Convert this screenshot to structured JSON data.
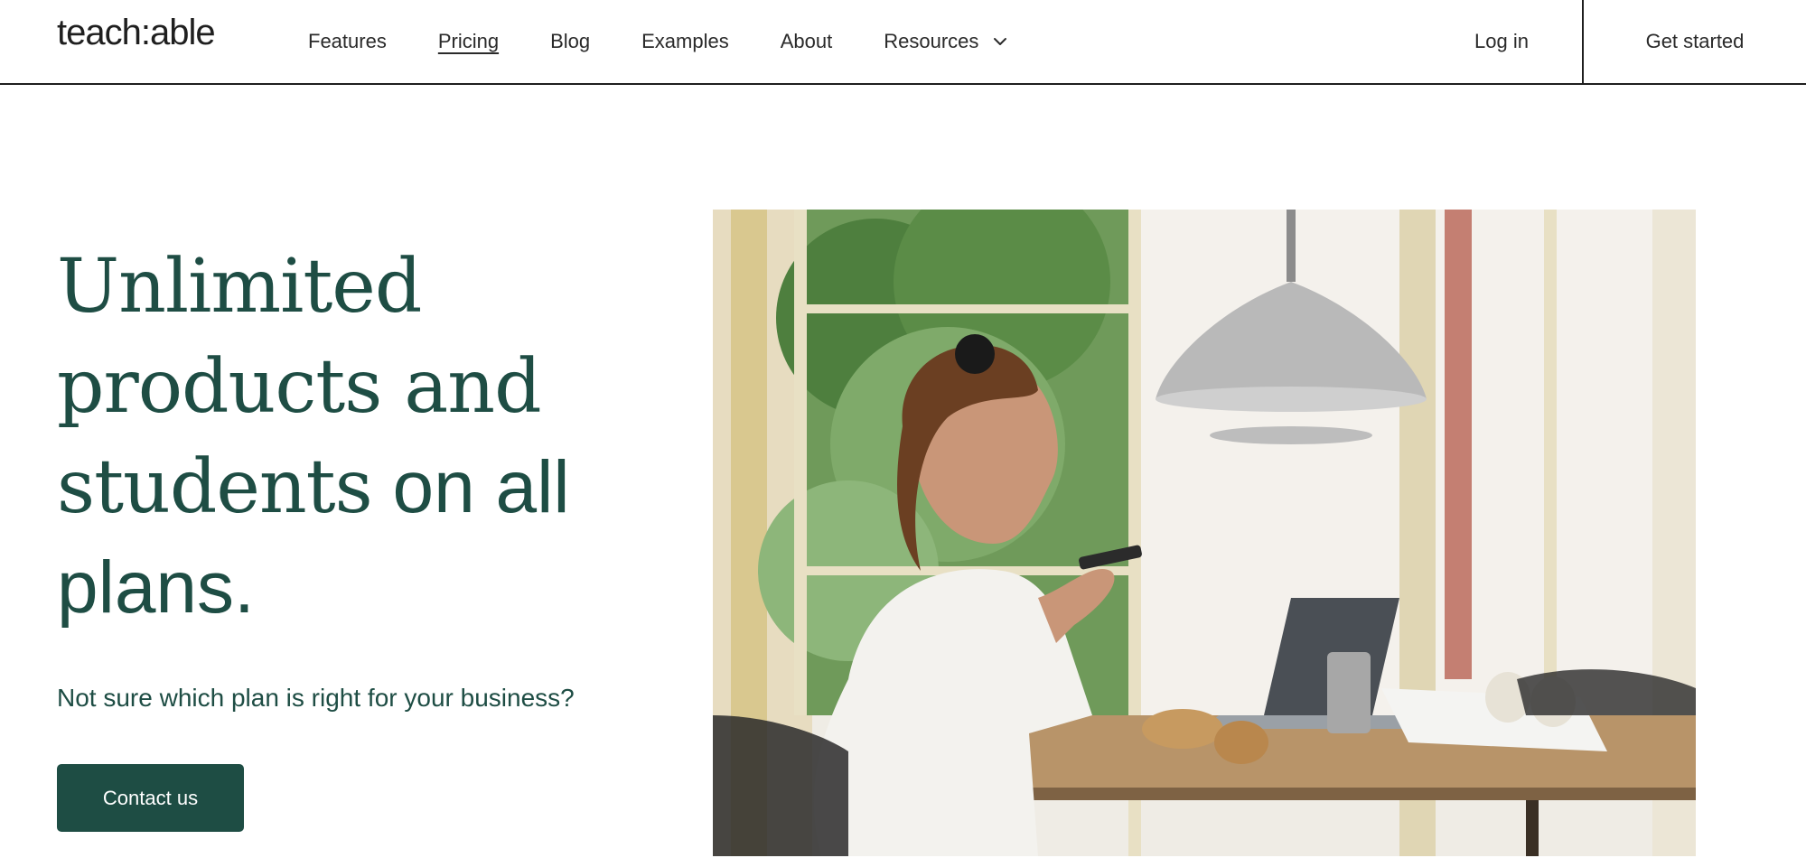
{
  "header": {
    "logo": "teach:able",
    "nav": [
      {
        "label": "Features"
      },
      {
        "label": "Pricing",
        "active": true
      },
      {
        "label": "Blog"
      },
      {
        "label": "Examples"
      },
      {
        "label": "About"
      },
      {
        "label": "Resources",
        "icon": "chevron-down-icon"
      }
    ],
    "login_label": "Log in",
    "get_started_label": "Get started"
  },
  "hero": {
    "title_serif_1": "Unlimited",
    "title_serif_2": "products and",
    "title_serif_3": "students",
    "title_sans_1": "on all",
    "title_sans_2": "plans.",
    "subtitle": "Not sure which plan is right for your business?",
    "cta_label": "Contact us"
  },
  "colors": {
    "brand_green": "#1e4d44",
    "text_dark": "#1f1f1f"
  },
  "image": {
    "icon": "photo-woman-working-at-table"
  }
}
